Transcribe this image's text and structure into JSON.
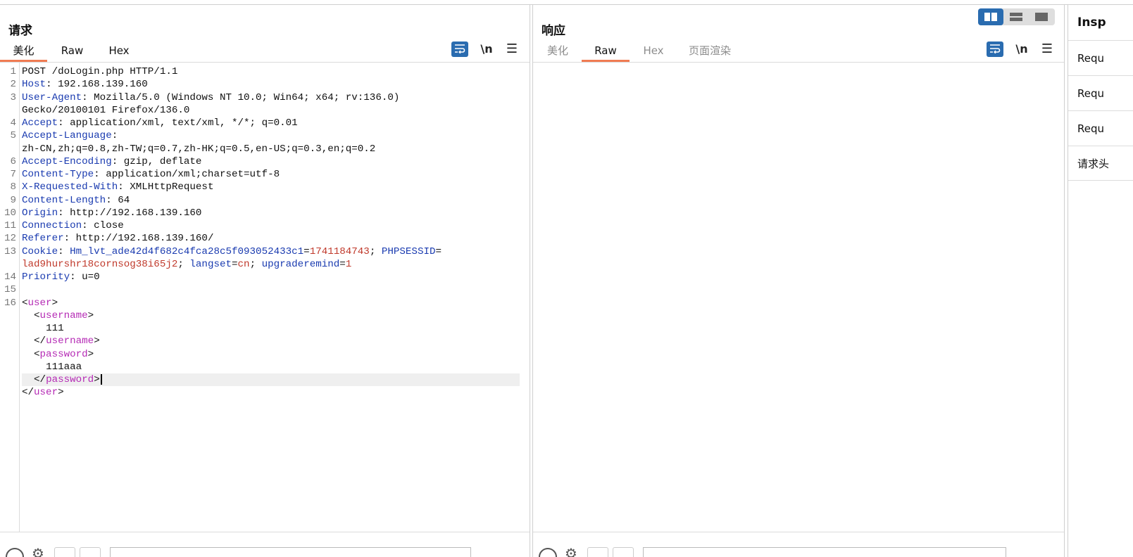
{
  "request": {
    "title": "请求",
    "tabs": [
      "美化",
      "Raw",
      "Hex"
    ],
    "newline_label": "\\n",
    "menu_label": "☰",
    "lines": [
      {
        "n": "1",
        "k": "",
        "v": "POST /doLogin.php HTTP/1.1"
      },
      {
        "n": "2",
        "k": "Host",
        "v": ": 192.168.139.160"
      },
      {
        "n": "3",
        "k": "User-Agent",
        "v": ": Mozilla/5.0 (Windows NT 10.0; Win64; x64; rv:136.0)"
      },
      {
        "n": "",
        "k": "",
        "v": "Gecko/20100101 Firefox/136.0"
      },
      {
        "n": "4",
        "k": "Accept",
        "v": ": application/xml, text/xml, */*; q=0.01"
      },
      {
        "n": "5",
        "k": "Accept-Language",
        "v": ":"
      },
      {
        "n": "",
        "k": "",
        "v": "zh-CN,zh;q=0.8,zh-TW;q=0.7,zh-HK;q=0.5,en-US;q=0.3,en;q=0.2"
      },
      {
        "n": "6",
        "k": "Accept-Encoding",
        "v": ": gzip, deflate"
      },
      {
        "n": "7",
        "k": "Content-Type",
        "v": ": application/xml;charset=utf-8"
      },
      {
        "n": "8",
        "k": "X-Requested-With",
        "v": ": XMLHttpRequest"
      },
      {
        "n": "9",
        "k": "Content-Length",
        "v": ": 64"
      },
      {
        "n": "10",
        "k": "Origin",
        "v": ": http://192.168.139.160"
      },
      {
        "n": "11",
        "k": "Connection",
        "v": ": close"
      },
      {
        "n": "12",
        "k": "Referer",
        "v": ": http://192.168.139.160/"
      }
    ],
    "cookie": {
      "n": "13",
      "k": "Cookie",
      "colon": ": ",
      "name1": "Hm_lvt_ade42d4f682c4fca28c5f093052433c1",
      "eq1": "=",
      "val1": "1741184743",
      "sep1": "; ",
      "name2": "PHPSESSID",
      "eq2": "=",
      "val2": "lad9hurshr18cornsog38i65j2",
      "sep2": "; ",
      "name3": "langset",
      "eq3": "=",
      "val3": "cn",
      "sep3": "; ",
      "name4": "upgraderemind",
      "eq4": "=",
      "val4": "1"
    },
    "priority": {
      "n": "14",
      "k": "Priority",
      "v": ": u=0"
    },
    "blank": {
      "n": "15"
    },
    "xml": {
      "n": "16",
      "open_lt": "<",
      "user": "user",
      "gt": ">",
      "username": "username",
      "username_value": "111",
      "close_lt": "</",
      "password": "password",
      "password_value": "111aaa"
    }
  },
  "response": {
    "title": "响应",
    "tabs": [
      "美化",
      "Raw",
      "Hex",
      "页面渲染"
    ],
    "newline_label": "\\n",
    "menu_label": "☰"
  },
  "inspector": {
    "title": "Insp",
    "items": [
      "Requ",
      "Requ",
      "Requ",
      "请求头"
    ]
  },
  "colors": {
    "accent": "#2a6cb0",
    "tab_underline": "#f07b53",
    "header_key": "#1a3bb0",
    "cookie_value": "#c0392b",
    "xml_tag": "#b52bb5"
  }
}
